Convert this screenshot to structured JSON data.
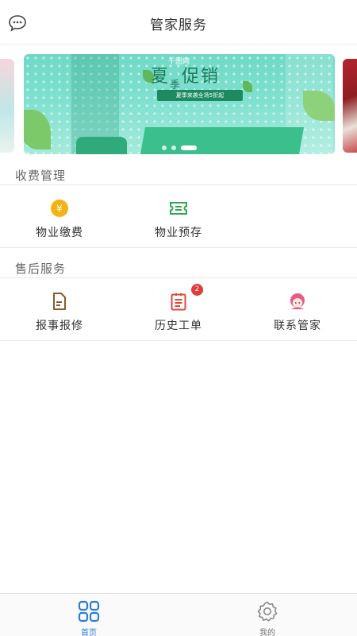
{
  "header": {
    "title": "管家服务",
    "left_icon": "chat-bubble-icon"
  },
  "banner": {
    "brand": "千图网",
    "headline_1": "夏",
    "headline_2": "季",
    "headline_3": "促销",
    "promo": "夏季来袭全场5折起",
    "slide_count": 3,
    "active_slide": 3,
    "colors": {
      "background": "#7fe0cf",
      "accent": "#1e7a5a"
    }
  },
  "billing": {
    "title": "收费管理",
    "items": [
      {
        "label": "物业缴费",
        "icon": "yen-coin-icon",
        "color": "#f2b313"
      },
      {
        "label": "物业预存",
        "icon": "ticket-icon",
        "color": "#2fa84f"
      }
    ]
  },
  "after_sales": {
    "title": "售后服务",
    "items": [
      {
        "label": "报事报修",
        "icon": "document-icon",
        "color": "#8a5a2b"
      },
      {
        "label": "历史工单",
        "icon": "clipboard-list-icon",
        "color": "#e0473a",
        "badge": "2"
      },
      {
        "label": "联系管家",
        "icon": "support-agent-icon",
        "color": "#e85a86"
      }
    ]
  },
  "tabbar": {
    "items": [
      {
        "label": "首页",
        "icon": "grid-home-icon",
        "active": true
      },
      {
        "label": "我的",
        "icon": "gear-icon",
        "active": false
      }
    ],
    "active_color": "#2b7fd6",
    "inactive_color": "#777777"
  }
}
